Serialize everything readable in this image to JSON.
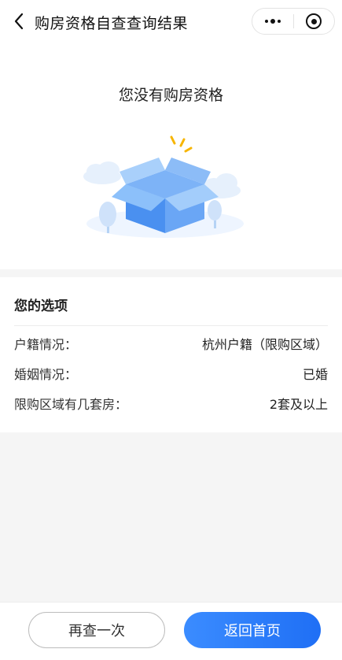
{
  "nav": {
    "title": "购房资格自查查询结果",
    "back_icon": "chevron-left-icon",
    "more_icon": "more-dots-icon",
    "close_icon": "target-icon"
  },
  "result": {
    "title": "您没有购房资格",
    "illustration": "empty-box-illustration",
    "colors": {
      "box": "#4a90f0",
      "accent": "#f7b500"
    }
  },
  "options": {
    "heading": "您的选项",
    "rows": [
      {
        "label": "户籍情况：",
        "value": "杭州户籍（限购区域）"
      },
      {
        "label": "婚姻情况：",
        "value": "已婚"
      },
      {
        "label": "限购区域有几套房：",
        "value": "2套及以上"
      }
    ]
  },
  "footer": {
    "again_label": "再查一次",
    "home_label": "返回首页",
    "colors": {
      "primary": "#2a7cf7"
    }
  }
}
